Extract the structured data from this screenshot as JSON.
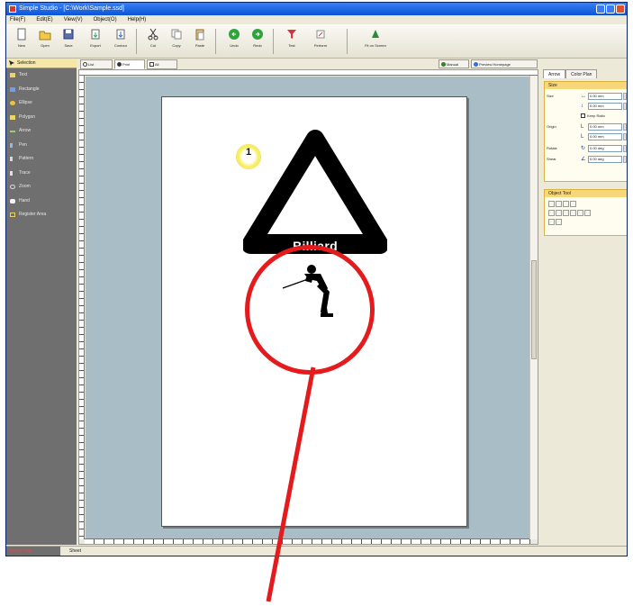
{
  "window": {
    "title": "Simple Studio - [C:\\Work\\Sample.ssd]"
  },
  "menu": [
    "File(F)",
    "Edit(E)",
    "View(V)",
    "Object(O)",
    "Help(H)"
  ],
  "toolbar": {
    "buttons": [
      "New",
      "Open",
      "Save",
      "Export",
      "Contour",
      "Cut",
      "Copy",
      "Paste",
      "Undo",
      "Redo",
      "Test",
      "Perform",
      "Fit on Screen"
    ]
  },
  "tool_pane": {
    "header": "Selection",
    "tools": [
      "Text",
      "Rectangle",
      "Ellipse",
      "Polygon",
      "Arrow",
      "Pen",
      "Pattern",
      "Trace",
      "Zoom",
      "Hand",
      "Register Area"
    ]
  },
  "document_tabs": [
    "List",
    "Print",
    "All"
  ],
  "props_buttons": [
    "Manual",
    "Preview Homepage"
  ],
  "props_tabs": [
    "Arrow",
    "Color Plan"
  ],
  "size_group": {
    "header": "Size",
    "rows": [
      {
        "label": "Size",
        "value": "0.00 mm"
      },
      {
        "label": "",
        "value": "0.00 mm"
      },
      {
        "label": "Keep Ratio",
        "checkbox": true
      },
      {
        "label": "Origin",
        "value": "0.00 mm"
      },
      {
        "label": "",
        "value": "0.00 mm"
      },
      {
        "label": "Rotate",
        "value": "0.00 deg"
      },
      {
        "label": "Shear",
        "value": "0.00 deg"
      }
    ]
  },
  "object_tool": {
    "header": "Object Tool"
  },
  "status_bar": {
    "left": "Ready (Alt)",
    "right": "Sheet"
  },
  "artwork": {
    "badge_number": "1",
    "sign_text": "Billiard"
  },
  "colors": {
    "callout": "#e41a1c",
    "title_bar": "#0a55d8",
    "tool_pane": "#6f6f6f",
    "canvas_bg": "#a9bdc6"
  }
}
